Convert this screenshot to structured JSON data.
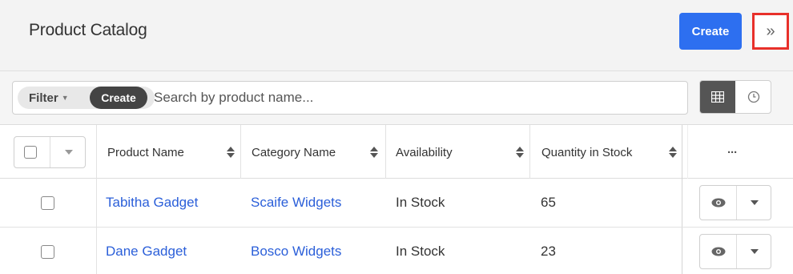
{
  "header": {
    "title": "Product Catalog",
    "create_label": "Create",
    "toggle_icon": "double-chevron-right-icon",
    "toggle_glyph": "»"
  },
  "filter": {
    "filter_label": "Filter",
    "create_label": "Create",
    "search_placeholder": "Search by product name...",
    "view_list_icon": "list-view-icon",
    "view_activity_icon": "clock-icon"
  },
  "table": {
    "columns": [
      "Product Name",
      "Category Name",
      "Availability",
      "Quantity in Stock"
    ],
    "actions_header": "···",
    "rows": [
      {
        "product_name": "Tabitha Gadget",
        "category_name": "Scaife Widgets",
        "availability": "In Stock",
        "quantity": "65"
      },
      {
        "product_name": "Dane Gadget",
        "category_name": "Bosco Widgets",
        "availability": "In Stock",
        "quantity": "23"
      }
    ]
  },
  "colors": {
    "primary": "#2d6ff0",
    "link": "#2b5fd9",
    "highlight": "#e8302a",
    "dark_pill": "#444444"
  }
}
